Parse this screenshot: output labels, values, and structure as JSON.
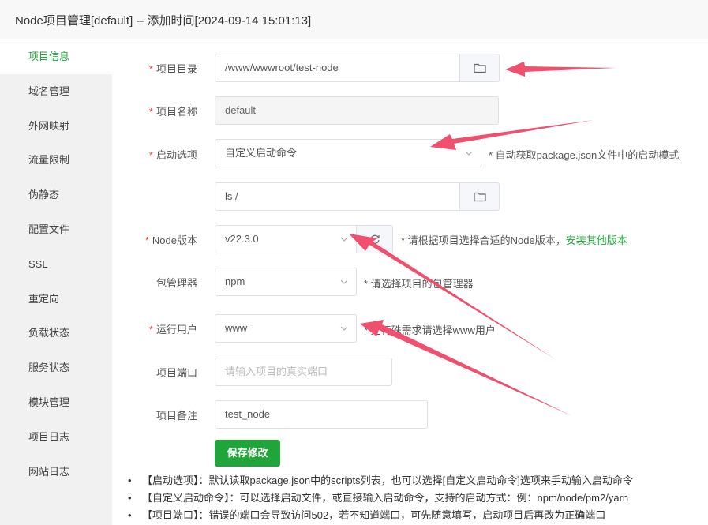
{
  "window": {
    "title": "Node项目管理[default] -- 添加时间[2024-09-14 15:01:13]"
  },
  "sidebar": {
    "items": [
      {
        "label": "项目信息",
        "active": true
      },
      {
        "label": "域名管理"
      },
      {
        "label": "外网映射"
      },
      {
        "label": "流量限制"
      },
      {
        "label": "伪静态"
      },
      {
        "label": "配置文件"
      },
      {
        "label": "SSL"
      },
      {
        "label": "重定向"
      },
      {
        "label": "负载状态"
      },
      {
        "label": "服务状态"
      },
      {
        "label": "模块管理"
      },
      {
        "label": "项目日志"
      },
      {
        "label": "网站日志"
      }
    ]
  },
  "form": {
    "required_mark": "*",
    "project_dir": {
      "label": "项目目录",
      "value": "/www/wwwroot/test-node",
      "icon": "folder-icon"
    },
    "project_name": {
      "label": "项目名称",
      "value": "default"
    },
    "start_option": {
      "label": "启动选项",
      "value": "自定义启动命令",
      "hint": "* 自动获取package.json文件中的启动模式"
    },
    "start_command": {
      "value": "ls /",
      "icon": "folder-icon"
    },
    "node_version": {
      "label": "Node版本",
      "value": "v22.3.0",
      "icon": "refresh-icon",
      "hint": "* 请根据项目选择合适的Node版本，",
      "hint_link": "安装其他版本"
    },
    "package_manager": {
      "label": "包管理器",
      "value": "npm",
      "hint": "* 请选择项目的包管理器"
    },
    "run_user": {
      "label": "运行用户",
      "value": "www",
      "hint": "* 无特殊需求请选择www用户"
    },
    "project_port": {
      "label": "项目端口",
      "placeholder": "请输入项目的真实端口"
    },
    "project_note": {
      "label": "项目备注",
      "value": "test_node"
    },
    "save_label": "保存修改"
  },
  "notes": [
    "【启动选项】：默认读取package.json中的scripts列表，也可以选择[自定义启动命令]选项来手动输入启动命令",
    "【自定义启动命令】：可以选择启动文件，或直接输入启动命令，支持的启动方式：例：npm/node/pm2/yarn",
    "【项目端口】：错误的端口会导致访问502，若不知道端口，可先随意填写，启动项目后再改为正确端口"
  ],
  "colors": {
    "accent": "#20a53a",
    "required": "#ef4444",
    "arrow": "#f0506e"
  }
}
